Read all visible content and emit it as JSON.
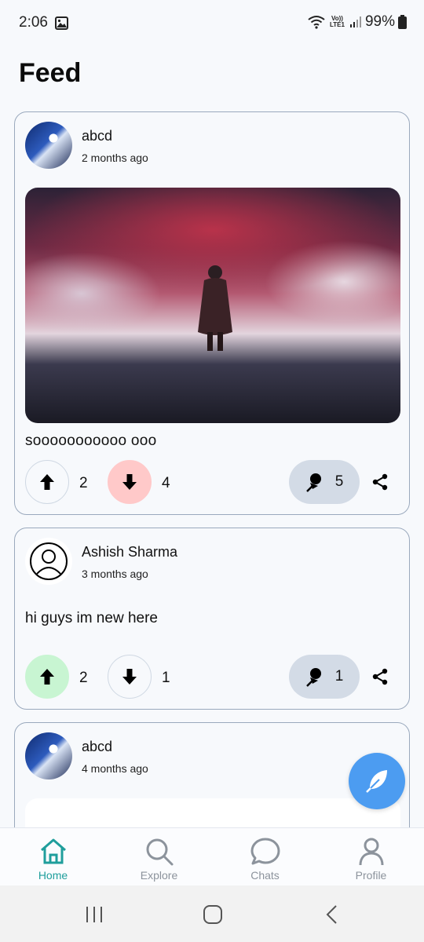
{
  "status_bar": {
    "time": "2:06",
    "network_label_top": "Vo))",
    "network_label_bottom": "LTE1",
    "battery": "99%"
  },
  "page": {
    "title": "Feed"
  },
  "posts": [
    {
      "author": "abcd",
      "time": "2 months ago",
      "text": "sooooooooooo ooo",
      "upvotes": "2",
      "downvotes": "4",
      "comments": "5",
      "vote_state": "down"
    },
    {
      "author": "Ashish Sharma",
      "time": "3 months ago",
      "text": "hi guys im new here",
      "upvotes": "2",
      "downvotes": "1",
      "comments": "1",
      "vote_state": "up"
    },
    {
      "author": "abcd",
      "time": "4 months ago"
    }
  ],
  "nav": {
    "items": [
      {
        "label": "Home",
        "icon": "home-icon",
        "active": true
      },
      {
        "label": "Explore",
        "icon": "search-icon",
        "active": false
      },
      {
        "label": "Chats",
        "icon": "chat-icon",
        "active": false
      },
      {
        "label": "Profile",
        "icon": "profile-icon",
        "active": false
      }
    ]
  },
  "colors": {
    "accent": "#1f9e9c",
    "fab": "#4c9cf1",
    "upvote_active": "#c8f5d2",
    "downvote_active": "#ffc9c9",
    "card_border": "#9aa9bd"
  }
}
